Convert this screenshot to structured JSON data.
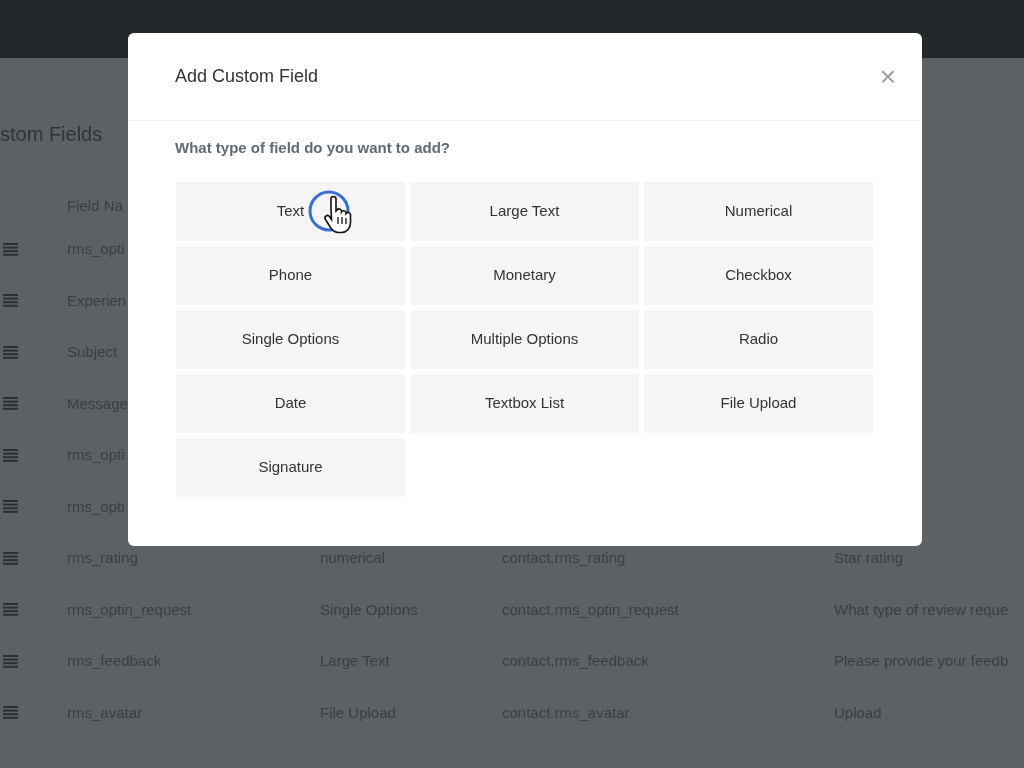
{
  "page": {
    "title": "stom Fields"
  },
  "table": {
    "columns": [
      "Field Na"
    ],
    "rows": [
      {
        "cells": [
          "rms_opti"
        ]
      },
      {
        "cells": [
          "Experien"
        ]
      },
      {
        "cells": [
          "Subject"
        ]
      },
      {
        "cells": [
          "Message"
        ]
      },
      {
        "cells": [
          "rms_opti"
        ]
      },
      {
        "cells": [
          "rms_opti"
        ]
      },
      {
        "cells": [
          "rms_rating",
          "numerical",
          "contact.rms_rating",
          "Star rating"
        ]
      },
      {
        "cells": [
          "rms_optin_request",
          "Single Options",
          "contact.rms_optin_request",
          "What type of review reque"
        ]
      },
      {
        "cells": [
          "rms_feedback",
          "Large Text",
          "contact.rms_feedback",
          "Please provide your feedb"
        ]
      },
      {
        "cells": [
          "rms_avatar",
          "File Upload",
          "contact.rms_avatar",
          "Upload"
        ]
      }
    ]
  },
  "dialog": {
    "title": "Add Custom Field",
    "close": "×",
    "question": "What type of field do you want to add?",
    "field_types": [
      {
        "label": "Text",
        "selected": true
      },
      {
        "label": "Large Text",
        "selected": false
      },
      {
        "label": "Numerical",
        "selected": false
      },
      {
        "label": "Phone",
        "selected": false
      },
      {
        "label": "Monetary",
        "selected": false
      },
      {
        "label": "Checkbox",
        "selected": false
      },
      {
        "label": "Single Options",
        "selected": false
      },
      {
        "label": "Multiple Options",
        "selected": false
      },
      {
        "label": "Radio",
        "selected": false
      },
      {
        "label": "Date",
        "selected": false
      },
      {
        "label": "Textbox List",
        "selected": false
      },
      {
        "label": "File Upload",
        "selected": false
      },
      {
        "label": "Signature",
        "selected": false
      }
    ]
  }
}
